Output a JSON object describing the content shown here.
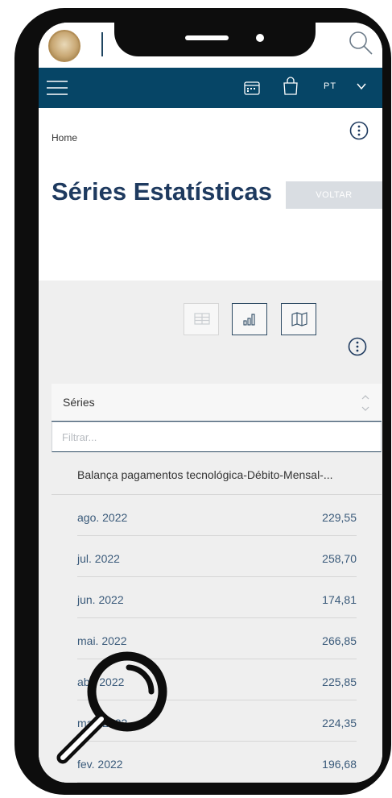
{
  "header": {
    "logo_icon": "central-bank-emblem-icon",
    "search_icon": "search-icon"
  },
  "navbar": {
    "menu_icon": "hamburger-menu-icon",
    "calendar_icon": "calendar-icon",
    "bag_icon": "shopping-bag-icon",
    "language": "PT",
    "language_dropdown_icon": "chevron-down-icon",
    "bg_color": "#064566"
  },
  "page": {
    "breadcrumb": "Home",
    "title": "Séries Estatísticas",
    "back_button": "VOLTAR"
  },
  "view_modes": [
    {
      "name": "table",
      "icon": "table-icon"
    },
    {
      "name": "chart",
      "icon": "bar-chart-icon"
    },
    {
      "name": "map",
      "icon": "map-icon"
    }
  ],
  "series_panel": {
    "header_label": "Séries",
    "filter_placeholder": "Filtrar...",
    "series_title": "Balança pagamentos tecnológica-Débito-Mensal-...",
    "rows": [
      {
        "date": "ago. 2022",
        "value": "229,55"
      },
      {
        "date": "jul. 2022",
        "value": "258,70"
      },
      {
        "date": "jun. 2022",
        "value": "174,81"
      },
      {
        "date": "mai. 2022",
        "value": "266,85"
      },
      {
        "date": "abr. 2022",
        "value": "225,85"
      },
      {
        "date": "mar. 2022",
        "value": "224,35"
      },
      {
        "date": "fev. 2022",
        "value": "196,68"
      }
    ]
  },
  "overlay": {
    "magnifier_icon": "magnifying-glass-icon"
  }
}
